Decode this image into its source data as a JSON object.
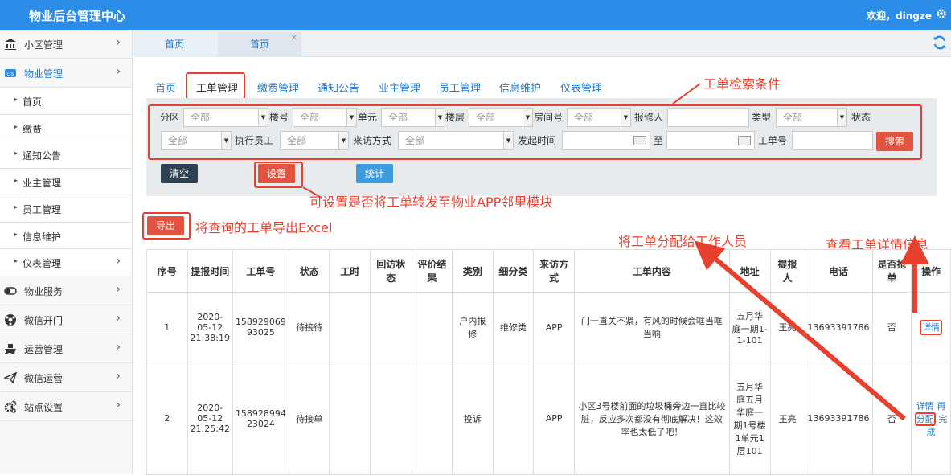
{
  "header": {
    "title": "物业后台管理中心",
    "welcome": "欢迎，dingze"
  },
  "sidebar": {
    "items": [
      {
        "label": "小区管理",
        "icon": "bank-icon"
      },
      {
        "label": "物业管理",
        "icon": "os-icon"
      },
      {
        "label": "物业服务",
        "icon": "toggle-icon"
      },
      {
        "label": "微信开门",
        "icon": "ball-icon"
      },
      {
        "label": "运营管理",
        "icon": "ship-icon"
      },
      {
        "label": "微信运营",
        "icon": "send-icon"
      },
      {
        "label": "站点设置",
        "icon": "gears-icon"
      }
    ],
    "sub": [
      "首页",
      "缴费",
      "通知公告",
      "业主管理",
      "员工管理",
      "信息维护",
      "仪表管理"
    ]
  },
  "tabs": [
    "首页",
    "首页"
  ],
  "nav": [
    "首页",
    "工单管理",
    "缴费管理",
    "通知公告",
    "业主管理",
    "员工管理",
    "信息维护",
    "仪表管理"
  ],
  "filters": {
    "district": "分区",
    "building": "楼号",
    "unit": "单元",
    "floor": "楼层",
    "room": "房间号",
    "reporter": "报修人",
    "type": "类型",
    "status": "状态",
    "staff": "执行员工",
    "visit_method": "来访方式",
    "start_time": "发起时间",
    "to": "至",
    "order_no": "工单号",
    "all": "全部"
  },
  "buttons": {
    "search": "搜索",
    "clear": "清空",
    "settings": "设置",
    "stats": "统计",
    "export": "导出"
  },
  "annotations": {
    "filter": "工单检索条件",
    "settings": "可设置是否将工单转发至物业APP邻里模块",
    "export": "将查询的工单导出Excel",
    "assign": "将工单分配给工作人员",
    "detail": "查看工单详情信息"
  },
  "table": {
    "headers": [
      "序号",
      "提报时间",
      "工单号",
      "状态",
      "工时",
      "回访状态",
      "评价结果",
      "类别",
      "细分类",
      "来访方式",
      "工单内容",
      "地址",
      "提报人",
      "电话",
      "是否抢单",
      "操作"
    ],
    "rows": [
      {
        "no": "1",
        "time": "2020-05-12 21:38:19",
        "order": "158929069 93025",
        "status": "待接待",
        "hours": "",
        "visit": "",
        "eval": "",
        "cat": "户内报修",
        "subcat": "维修类",
        "method": "APP",
        "content": "门一直关不紧，有风的时候会哐当哐当响",
        "addr": "五月华庭一期1-1-101",
        "reporter": "王亮",
        "phone": "13693391786",
        "grab": "否",
        "ops": [
          "详情"
        ]
      },
      {
        "no": "2",
        "time": "2020-05-12 21:25:42",
        "order": "158928994 23024",
        "status": "待接单",
        "hours": "",
        "visit": "",
        "eval": "",
        "cat": "投诉",
        "subcat": "",
        "method": "APP",
        "content": "小区3号楼前面的垃圾桶旁边一直比较脏，反应多次都没有彻底解决！这效率也太低了吧！",
        "addr": "五月华庭五月华庭一期1号楼1单元1层101",
        "reporter": "王亮",
        "phone": "13693391786",
        "grab": "否",
        "ops": [
          "详情",
          "再",
          "分配",
          "完成"
        ]
      }
    ]
  },
  "colors": {
    "header": "#2b8de8",
    "annotation": "#e8402e",
    "link": "#2a79c7"
  }
}
